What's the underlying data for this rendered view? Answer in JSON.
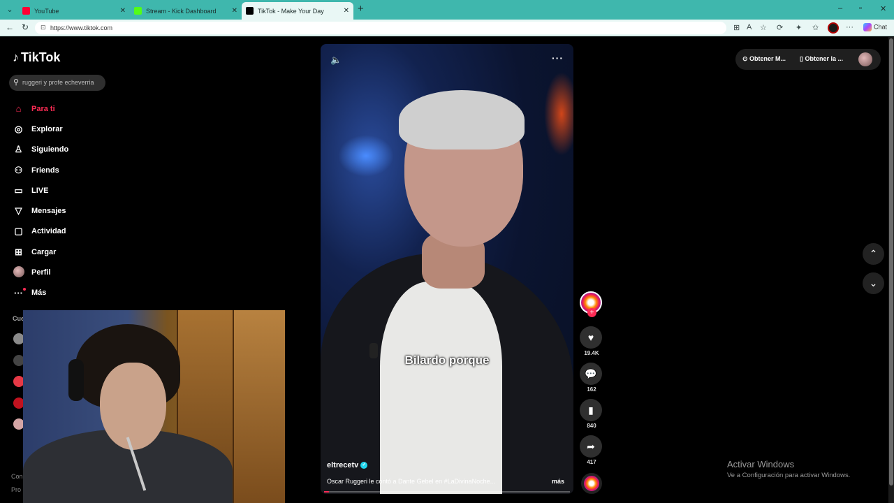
{
  "browser": {
    "tabs": [
      {
        "title": "YouTube",
        "color": "#ff0033"
      },
      {
        "title": "Stream - Kick Dashboard",
        "color": "#53fc18"
      },
      {
        "title": "TikTok - Make Your Day",
        "color": "#000000"
      }
    ],
    "url": "https://www.tiktok.com",
    "chat_label": "Chat"
  },
  "tiktok": {
    "logo": "TikTok",
    "search_placeholder": "ruggeri y profe echeverria",
    "nav": [
      {
        "label": "Para ti",
        "icon": "home-icon",
        "glyph": "⌂"
      },
      {
        "label": "Explorar",
        "icon": "compass-icon",
        "glyph": "◎"
      },
      {
        "label": "Siguiendo",
        "icon": "following-icon",
        "glyph": "♙"
      },
      {
        "label": "Friends",
        "icon": "friends-icon",
        "glyph": "⚇"
      },
      {
        "label": "LIVE",
        "icon": "live-icon",
        "glyph": "▭"
      },
      {
        "label": "Mensajes",
        "icon": "messages-icon",
        "glyph": "▽"
      },
      {
        "label": "Actividad",
        "icon": "activity-icon",
        "glyph": "▢"
      },
      {
        "label": "Cargar",
        "icon": "upload-icon",
        "glyph": "⊞"
      },
      {
        "label": "Perfil",
        "icon": "avatar",
        "glyph": ""
      },
      {
        "label": "Más",
        "icon": "more-icon",
        "glyph": "···"
      }
    ],
    "section_label": "Cue",
    "footer": [
      "Con",
      "Pro"
    ],
    "video": {
      "caption": "Bilardo porque",
      "author": "eltrecetv",
      "description": "Oscar Ruggeri le contó a Dante Gebel en #LaDivinaNoche...",
      "more": "más",
      "progress": 0.02
    },
    "actions": {
      "likes": "19.4K",
      "comments": "162",
      "saves": "840",
      "shares": "417"
    },
    "top_buttons": [
      "Obtener M...",
      "Obtener la ..."
    ]
  },
  "windows": {
    "activate_title": "Activar Windows",
    "activate_sub": "Ve a Configuración para activar Windows."
  },
  "colors": {
    "accent": "#fe2c55",
    "chrome": "#3fb7ad"
  }
}
